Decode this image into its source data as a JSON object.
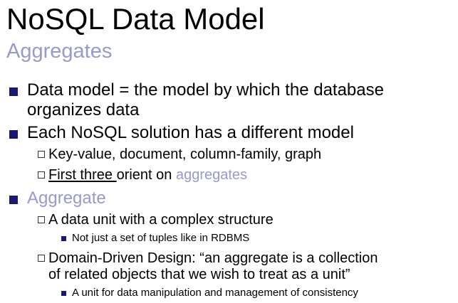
{
  "slide": {
    "title": "NoSQL Data Model",
    "subtitle": "Aggregates",
    "bullets": [
      {
        "line1": "Data model = the model by which the database",
        "line2": "organizes data"
      },
      {
        "text": "Each NoSQL solution has a different model",
        "sub": [
          {
            "text": "Key-value, document, column-family, graph"
          },
          {
            "underlined": "First three ",
            "middle": "orient on ",
            "accent": "aggregates"
          }
        ]
      },
      {
        "text": "Aggregate",
        "sub": [
          {
            "text": "A data unit with a complex structure",
            "sub": [
              {
                "text": "Not just a set of tuples like in RDBMS"
              }
            ]
          },
          {
            "line1": "Domain-Driven Design: “an aggregate is a collection",
            "line2": "of related objects that we wish to treat as a unit”",
            "sub": [
              {
                "text": "A unit for data manipulation and management of consistency"
              }
            ]
          }
        ]
      }
    ]
  },
  "colors": {
    "accent": "#9999cc",
    "bullet": "#191970",
    "text": "#000000",
    "background": "#ffffff"
  }
}
